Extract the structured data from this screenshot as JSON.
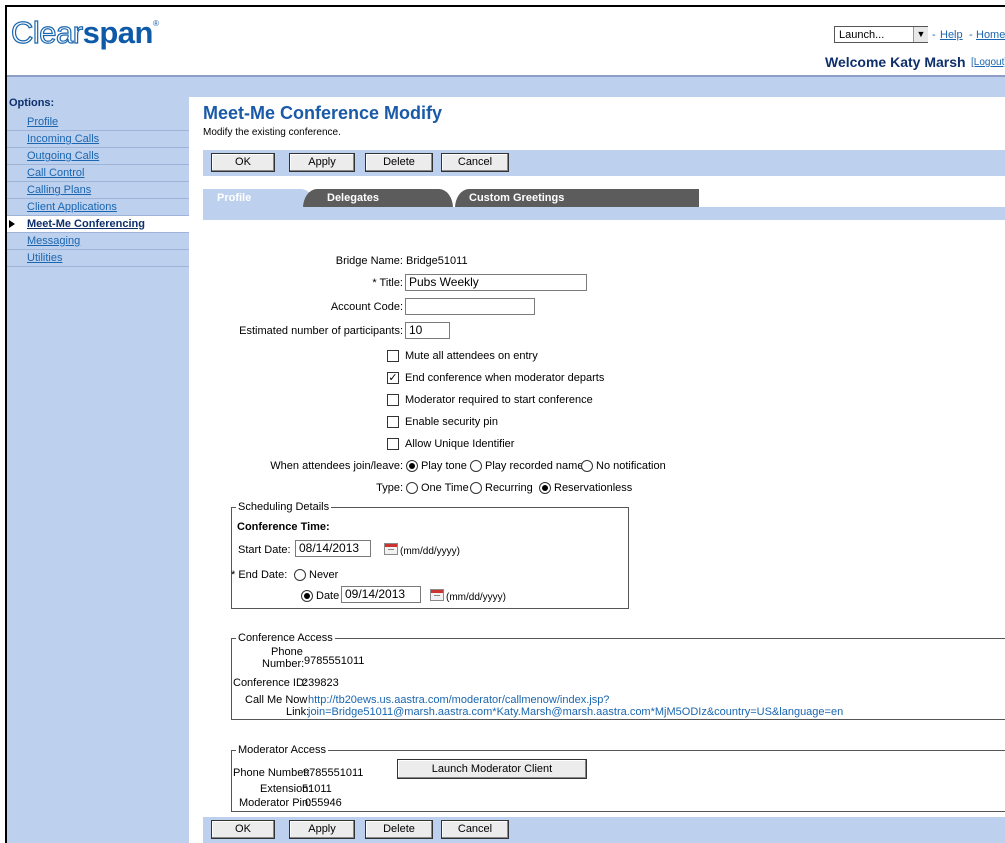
{
  "header": {
    "logo_part1": "Clear",
    "logo_part2": "span",
    "logo_mark": "®",
    "launch_select": "Launch...",
    "help_link": "Help",
    "home_link": "Home",
    "sep": "-",
    "welcome": "Welcome Katy Marsh",
    "logout": "[Logout]"
  },
  "sidebar": {
    "label": "Options:",
    "items": [
      {
        "label": "Profile"
      },
      {
        "label": "Incoming Calls"
      },
      {
        "label": "Outgoing Calls"
      },
      {
        "label": "Call Control"
      },
      {
        "label": "Calling Plans"
      },
      {
        "label": "Client Applications"
      },
      {
        "label": "Meet-Me Conferencing"
      },
      {
        "label": "Messaging"
      },
      {
        "label": "Utilities"
      }
    ]
  },
  "page": {
    "title": "Meet-Me Conference Modify",
    "description": "Modify the existing conference."
  },
  "buttons": {
    "ok": "OK",
    "apply": "Apply",
    "delete": "Delete",
    "cancel": "Cancel"
  },
  "tabs": [
    "Profile",
    "Delegates",
    "Custom Greetings"
  ],
  "form": {
    "bridge_name_label": "Bridge Name:",
    "bridge_name": "Bridge51011",
    "title_label": "* Title:",
    "title_value": "Pubs Weekly",
    "account_code_label": "Account Code:",
    "account_code_value": "",
    "participants_label": "Estimated number of participants:",
    "participants_value": "10",
    "checkboxes": [
      {
        "label": "Mute all attendees on entry",
        "checked": false
      },
      {
        "label": "End conference when moderator departs",
        "checked": true
      },
      {
        "label": "Moderator required to start conference",
        "checked": false
      },
      {
        "label": "Enable security pin",
        "checked": false
      },
      {
        "label": "Allow Unique Identifier",
        "checked": false
      }
    ],
    "join_leave_label": "When attendees join/leave:",
    "join_leave_options": [
      "Play tone",
      "Play recorded name",
      "No notification"
    ],
    "type_label": "Type:",
    "type_options": [
      "One Time",
      "Recurring",
      "Reservationless"
    ]
  },
  "scheduling": {
    "legend": "Scheduling Details",
    "conference_time": "Conference Time:",
    "start_date_label": "Start Date:",
    "start_date": "08/14/2013",
    "date_format": "(mm/dd/yyyy)",
    "end_date_label": "* End Date:",
    "never": "Never",
    "date_label": "Date",
    "end_date": "09/14/2013"
  },
  "access": {
    "legend": "Conference Access",
    "phone_label_1": "Phone",
    "phone_label_2": "Number:",
    "phone": "9785551011",
    "conf_id_label": "Conference ID:",
    "conf_id": "239823",
    "callme_label_1": "Call Me Now",
    "callme_label_2": "Link:",
    "callme_url_1": "http://tb20ews.us.aastra.com/moderator/callmenow/index.jsp?",
    "callme_url_2": "join=Bridge51011@marsh.aastra.com*Katy.Marsh@marsh.aastra.com*MjM5ODIz&country=US&language=en"
  },
  "moderator": {
    "legend": "Moderator Access",
    "phone_label": "Phone Number:",
    "phone": "9785551011",
    "launch_button": "Launch Moderator Client",
    "ext_label": "Extension:",
    "ext": "51011",
    "pin_label": "Moderator Pin:",
    "pin": "055946"
  }
}
